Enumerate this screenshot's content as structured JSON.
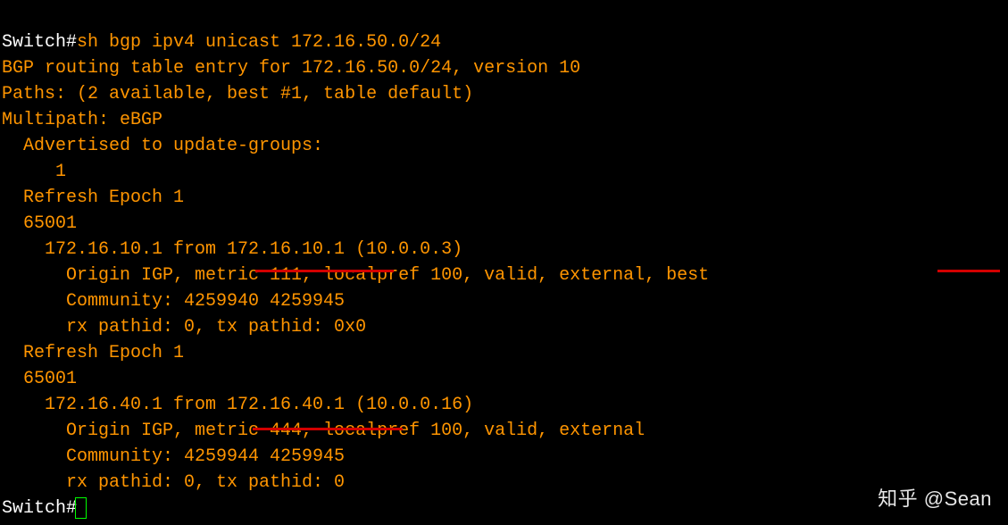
{
  "terminal": {
    "prompt_text": "Switch#",
    "command": "sh bgp ipv4 unicast 172.16.50.0/24",
    "lines": {
      "header1": "BGP routing table entry for 172.16.50.0/24, version 10",
      "header2": "Paths: (2 available, best #1, table default)",
      "header3": "Multipath: eBGP",
      "adv1": "  Advertised to update-groups:",
      "adv2": "     1",
      "path1": {
        "refresh": "  Refresh Epoch 1",
        "as": "  65001",
        "nexthop": "    172.16.10.1 from 172.16.10.1 (10.0.0.3)",
        "attrs": "      Origin IGP, metric 111, localpref 100, valid, external, best",
        "comm": "      Community: 4259940 4259945",
        "rx": "      rx pathid: 0, tx pathid: 0x0"
      },
      "path2": {
        "refresh": "  Refresh Epoch 1",
        "as": "  65001",
        "nexthop": "    172.16.40.1 from 172.16.40.1 (10.0.0.16)",
        "attrs": "      Origin IGP, metric 444, localpref 100, valid, external",
        "comm": "      Community: 4259944 4259945",
        "rx": "      rx pathid: 0, tx pathid: 0"
      }
    }
  },
  "watermark": "知乎 @Sean"
}
